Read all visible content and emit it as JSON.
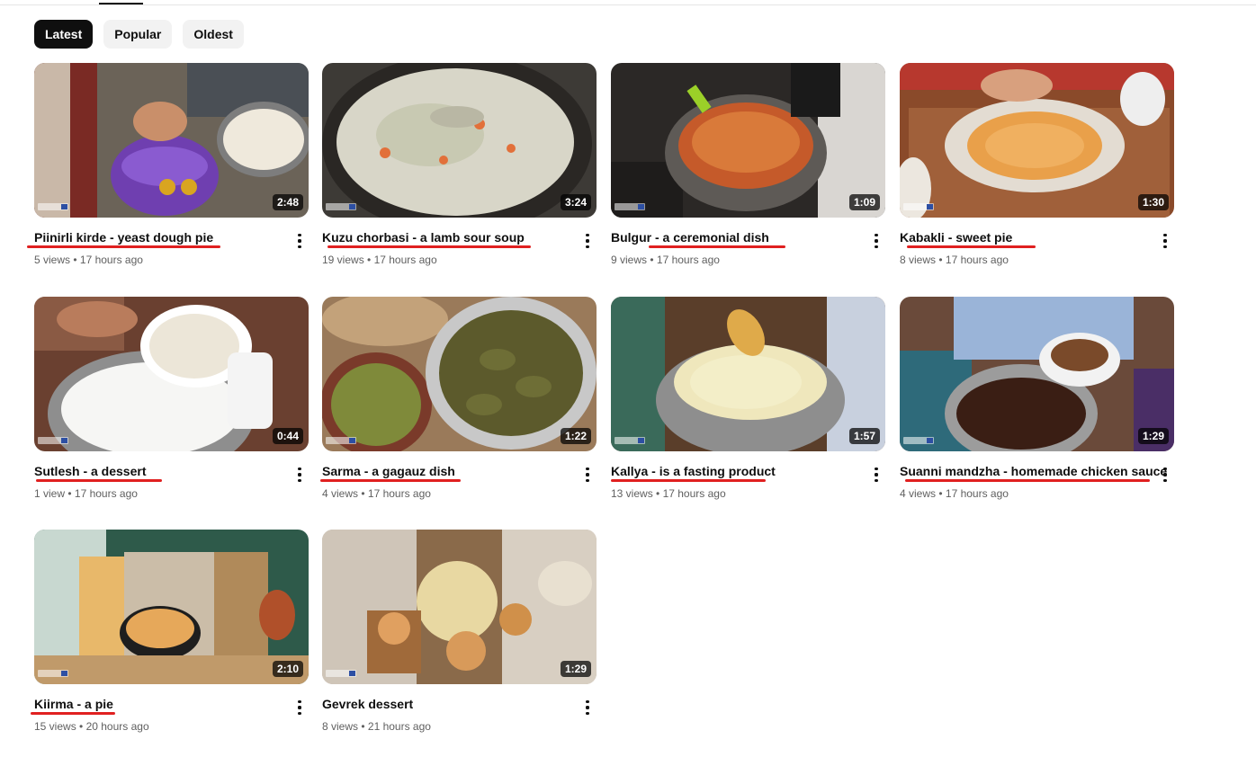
{
  "filter_chips": [
    {
      "label": "Latest",
      "active": true
    },
    {
      "label": "Popular",
      "active": false
    },
    {
      "label": "Oldest",
      "active": false
    }
  ],
  "colors": {
    "active_chip": "#0f0f0f",
    "chip": "#f2f2f2",
    "annotation_underline": "#e02020"
  },
  "videos": [
    {
      "title": "Piinirli kirde - yeast dough pie",
      "views": "5 views",
      "age": "17 hours ago",
      "duration": "2:48",
      "underlined": true
    },
    {
      "title": "Kuzu chorbasi - a lamb sour soup",
      "views": "19 views",
      "age": "17 hours ago",
      "duration": "3:24",
      "underlined": true
    },
    {
      "title": "Bulgur - a ceremonial dish",
      "views": "9 views",
      "age": "17 hours ago",
      "duration": "1:09",
      "underlined": true
    },
    {
      "title": "Kabakli - sweet pie",
      "views": "8 views",
      "age": "17 hours ago",
      "duration": "1:30",
      "underlined": true
    },
    {
      "title": "Sutlesh - a dessert",
      "views": "1 view",
      "age": "17 hours ago",
      "duration": "0:44",
      "underlined": true
    },
    {
      "title": "Sarma - a gagauz dish",
      "views": "4 views",
      "age": "17 hours ago",
      "duration": "1:22",
      "underlined": true
    },
    {
      "title": "Kallya - is a fasting product",
      "views": "13 views",
      "age": "17 hours ago",
      "duration": "1:57",
      "underlined": true
    },
    {
      "title": "Suanni mandzha - homemade chicken sauce",
      "views": "4 views",
      "age": "17 hours ago",
      "duration": "1:29",
      "underlined": true
    },
    {
      "title": "Kiirma - a pie",
      "views": "15 views",
      "age": "20 hours ago",
      "duration": "2:10",
      "underlined": true
    },
    {
      "title": "Gevrek dessert",
      "views": "8 views",
      "age": "21 hours ago",
      "duration": "1:29",
      "underlined": false
    }
  ]
}
